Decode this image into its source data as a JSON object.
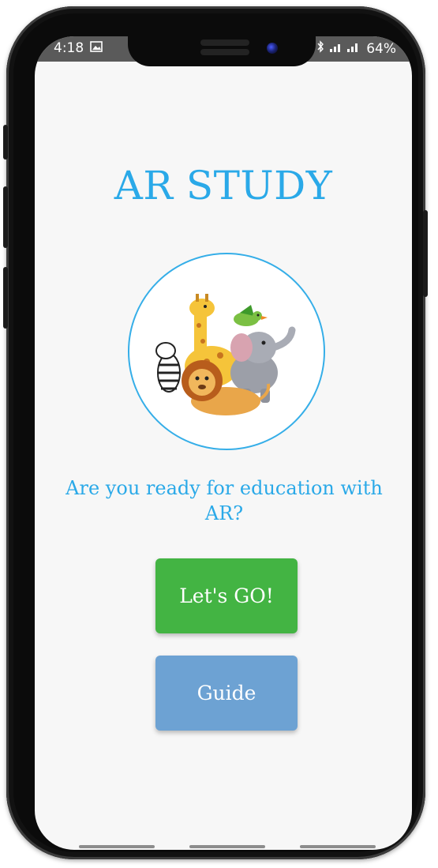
{
  "status_bar": {
    "time": "4:18",
    "battery": "64%"
  },
  "app": {
    "title": "AR STUDY",
    "question": "Are you ready for education with AR?",
    "lets_go_label": "Let's GO!",
    "guide_label": "Guide"
  },
  "icons": {
    "gallery": "gallery-icon",
    "bluetooth": "bluetooth-icon",
    "signal": "signal-icon",
    "logo": "animals-logo"
  },
  "colors": {
    "title": "#2aa9e8",
    "lets_go_button": "#43b443",
    "guide_button": "#6da2d3",
    "status_bar": "#5a5a5a"
  }
}
